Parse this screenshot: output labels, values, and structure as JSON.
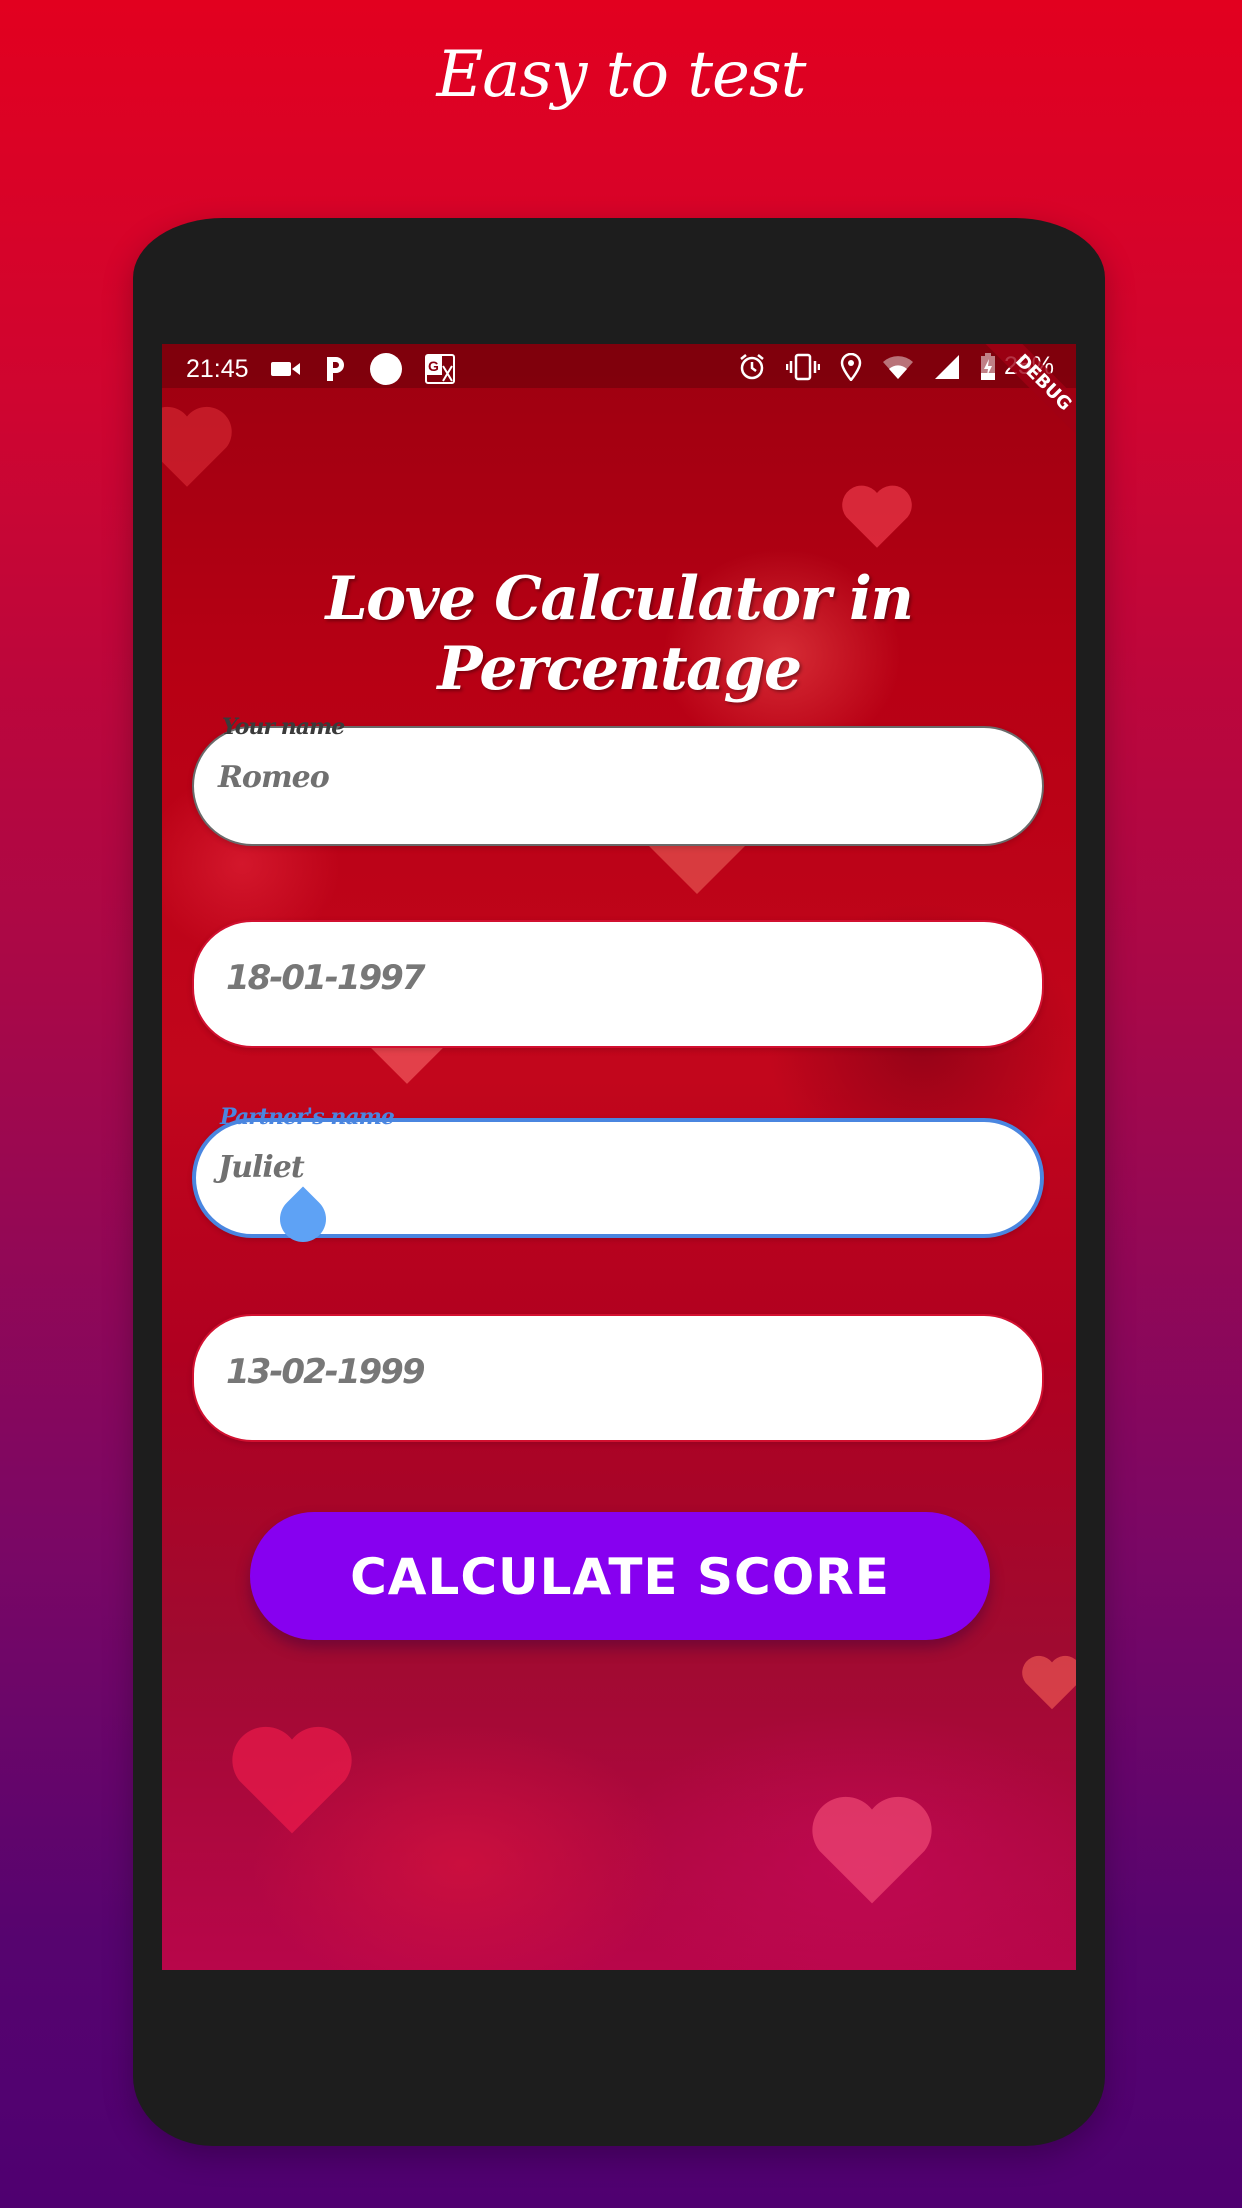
{
  "promo": {
    "title": "Easy to test"
  },
  "status_bar": {
    "time": "21:45",
    "left_icons": [
      "video-camera-icon",
      "parking-app-icon",
      "circle-notification-icon",
      "translate-icon"
    ],
    "right_icons": [
      "alarm-icon",
      "vibrate-icon",
      "location-icon",
      "wifi-icon",
      "cell-signal-icon",
      "battery-charging-icon"
    ],
    "battery": "25%",
    "debug_banner": "DEBUG"
  },
  "app": {
    "title": "Love Calculator in Percentage",
    "fields": {
      "your_name": {
        "label": "Your name",
        "value": "Romeo"
      },
      "your_dob": {
        "value": "18-01-1997"
      },
      "partner_name": {
        "label": "Partner's name",
        "value": "Juliet"
      },
      "partner_dob": {
        "value": "13-02-1999"
      }
    },
    "calculate_button": "CALCULATE SCORE"
  },
  "colors": {
    "accent_focus": "#4a86e0",
    "button": "#8700f0",
    "field_border": "#d21030",
    "bg_top": "#e2001f",
    "bg_bottom": "#4f0070"
  }
}
